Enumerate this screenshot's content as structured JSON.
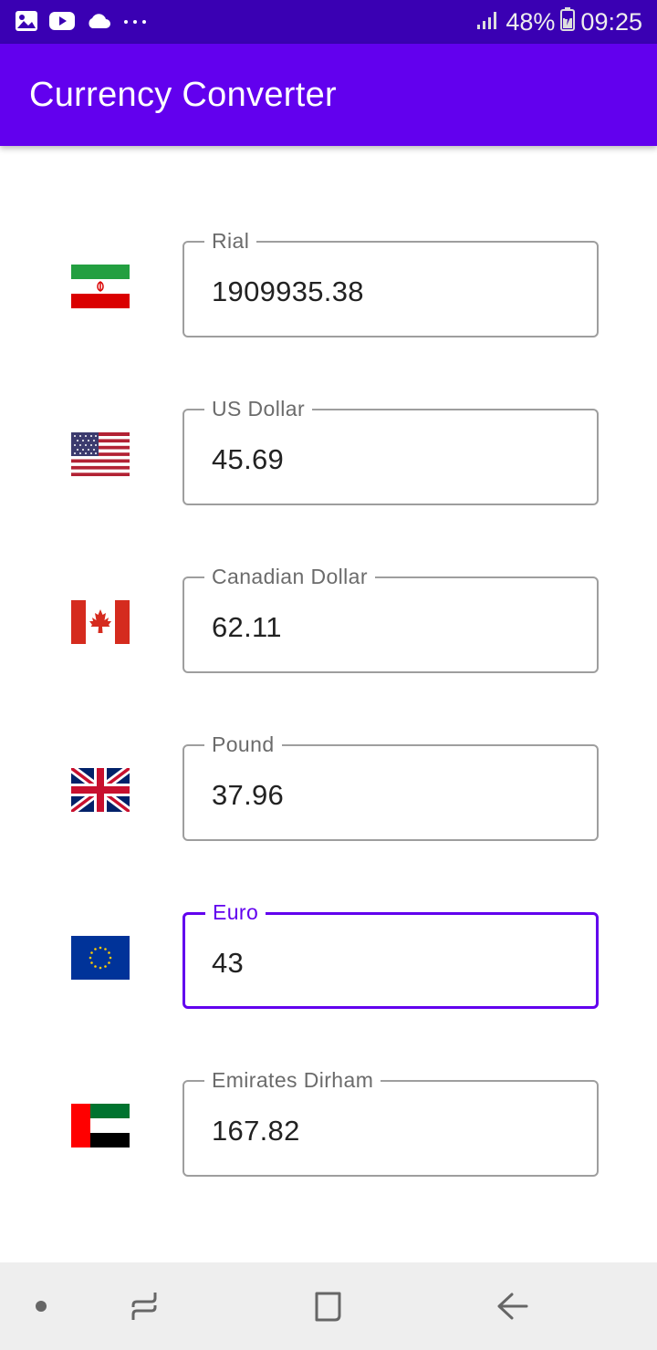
{
  "status_bar": {
    "battery": "48%",
    "time": "09:25",
    "icons": [
      "image-icon",
      "youtube-icon",
      "cloud-icon",
      "more-dots-icon",
      "signal-icon",
      "battery-icon"
    ]
  },
  "app_bar": {
    "title": "Currency Converter"
  },
  "currencies": [
    {
      "label": "Rial",
      "value": "1909935.38",
      "flag": "iran-flag-icon"
    },
    {
      "label": "US Dollar",
      "value": "45.69",
      "flag": "usa-flag-icon"
    },
    {
      "label": "Canadian Dollar",
      "value": "62.11",
      "flag": "canada-flag-icon"
    },
    {
      "label": "Pound",
      "value": "37.96",
      "flag": "uk-flag-icon"
    },
    {
      "label": "Euro",
      "value": "43",
      "flag": "eu-flag-icon",
      "focused": true
    },
    {
      "label": "Emirates Dirham",
      "value": "167.82",
      "flag": "uae-flag-icon"
    }
  ],
  "nav_bar": {
    "icons": [
      "nav-dot-icon",
      "recent-apps-icon",
      "home-icon",
      "back-icon"
    ]
  },
  "colors": {
    "status_bar": "#3a00b3",
    "app_bar": "#6200ee",
    "focus_accent": "#6200ee",
    "field_border": "#9e9e9e",
    "nav_bar": "#eeeeee"
  }
}
